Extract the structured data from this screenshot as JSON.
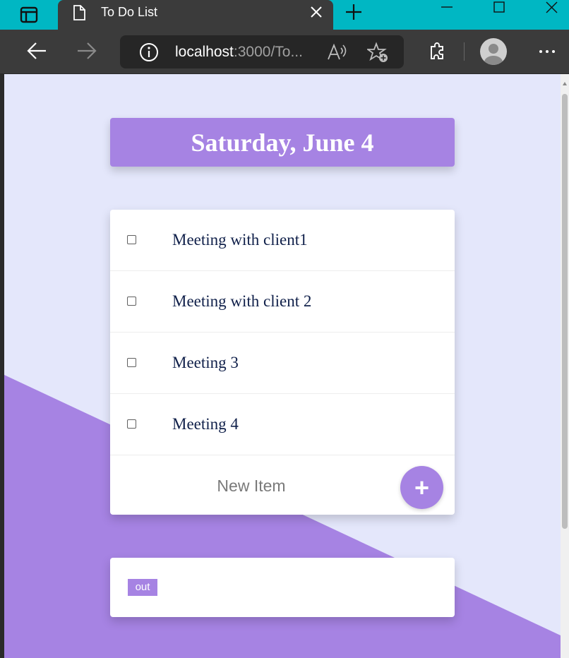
{
  "browser": {
    "tab_title": "To Do List",
    "url_host": "localhost",
    "url_rest": ":3000/To..."
  },
  "page": {
    "heading": "Saturday, June 4",
    "items": [
      {
        "label": "Meeting with client1",
        "checked": false
      },
      {
        "label": "Meeting with client 2",
        "checked": false
      },
      {
        "label": "Meeting 3",
        "checked": false
      },
      {
        "label": "Meeting 4",
        "checked": false
      }
    ],
    "new_item_placeholder": "New Item",
    "add_button": "+",
    "out_button": "out"
  },
  "colors": {
    "accent": "#A683E3",
    "background": "#E4E7FB",
    "tabbar": "#00B7C3",
    "chrome": "#3B3B3B"
  }
}
